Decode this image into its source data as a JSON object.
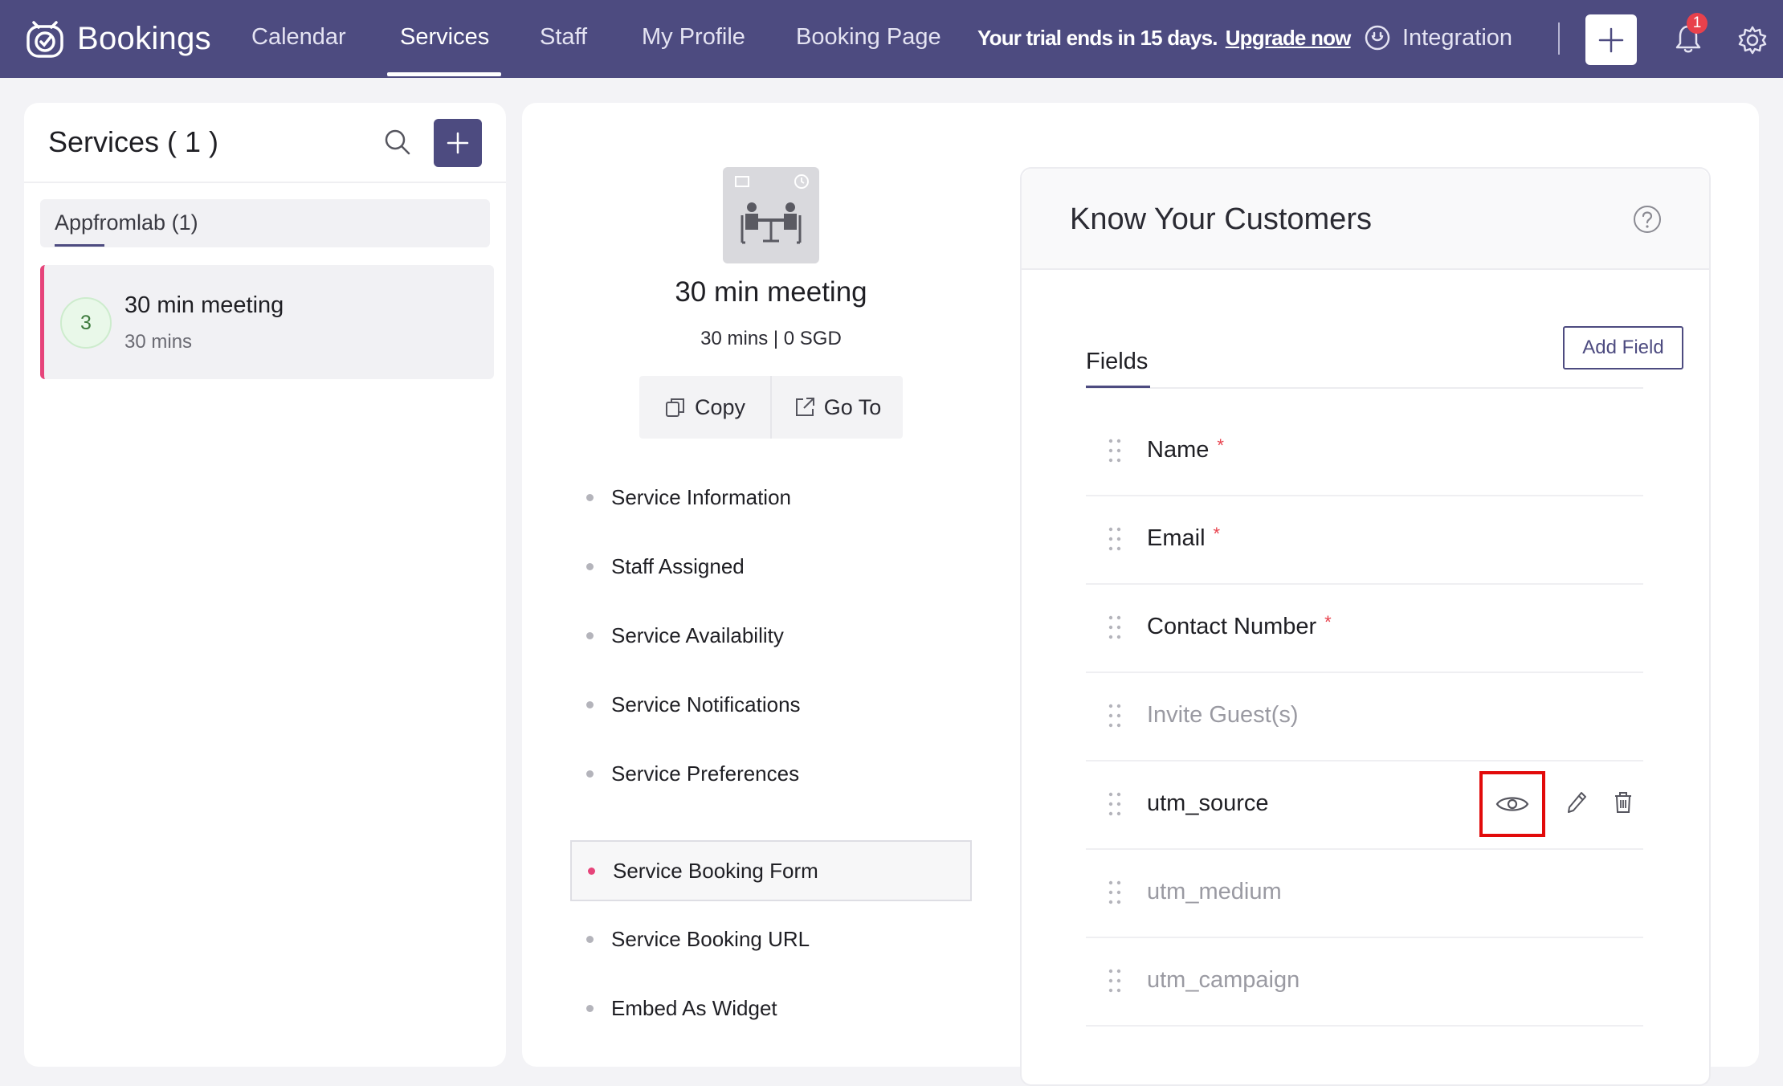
{
  "app": {
    "name": "Bookings"
  },
  "nav": {
    "items": [
      {
        "label": "Calendar"
      },
      {
        "label": "Services",
        "active": true
      },
      {
        "label": "Staff"
      },
      {
        "label": "My Profile"
      },
      {
        "label": "Booking Page"
      }
    ],
    "trial_text": "Your trial ends in 15 days.",
    "upgrade_label": "Upgrade now",
    "integration_label": "Integration",
    "notification_count": "1"
  },
  "colors": {
    "brand": "#4d4b80",
    "accent": "#e6447a",
    "required": "#e8414c",
    "highlight_box": "#e20a0a"
  },
  "services_panel": {
    "title": "Services ( 1 )",
    "group_label": "Appfromlab (1)",
    "services": [
      {
        "avatar": "3",
        "name": "30 min meeting",
        "duration": "30 mins"
      }
    ]
  },
  "service_detail": {
    "title": "30 min meeting",
    "meta": "30 mins | 0 SGD",
    "copy_label": "Copy",
    "goto_label": "Go To",
    "menu": [
      {
        "label": "Service Information"
      },
      {
        "label": "Staff Assigned"
      },
      {
        "label": "Service Availability"
      },
      {
        "label": "Service Notifications"
      },
      {
        "label": "Service Preferences"
      },
      {
        "label": "Service Booking Form",
        "active": true
      },
      {
        "label": "Service Booking URL"
      },
      {
        "label": "Embed As Widget"
      }
    ]
  },
  "kyc": {
    "title": "Know Your Customers",
    "fields_tab": "Fields",
    "add_field_label": "Add Field",
    "required_mark": "*",
    "fields": [
      {
        "label": "Name",
        "required": true,
        "hidden": false
      },
      {
        "label": "Email",
        "required": true,
        "hidden": false
      },
      {
        "label": "Contact Number",
        "required": true,
        "hidden": false
      },
      {
        "label": "Invite Guest(s)",
        "required": false,
        "hidden": true
      },
      {
        "label": "utm_source",
        "required": false,
        "hidden": false,
        "hovered": true
      },
      {
        "label": "utm_medium",
        "required": false,
        "hidden": true
      },
      {
        "label": "utm_campaign",
        "required": false,
        "hidden": true
      }
    ]
  }
}
